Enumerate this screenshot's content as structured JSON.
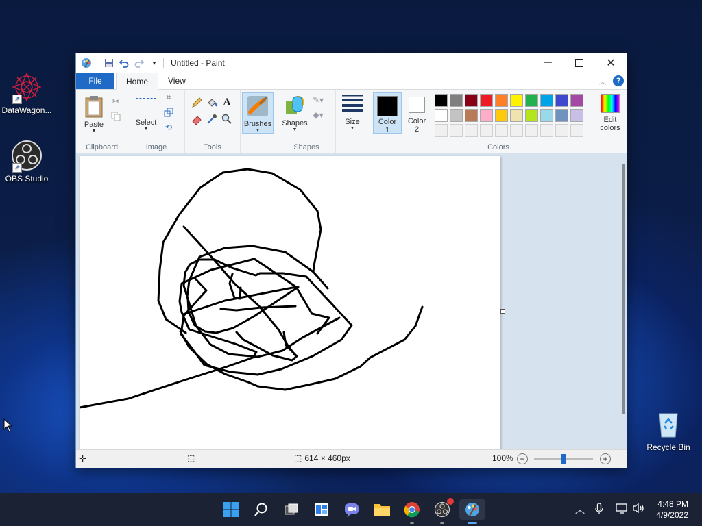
{
  "desktop": {
    "icons": [
      {
        "label": "DataWagon..."
      },
      {
        "label": "OBS Studio"
      },
      {
        "label": "Recycle Bin"
      }
    ]
  },
  "window": {
    "title": "Untitled - Paint",
    "tabs": {
      "file": "File",
      "home": "Home",
      "view": "View"
    }
  },
  "ribbon": {
    "clipboard": {
      "label": "Clipboard",
      "paste": "Paste"
    },
    "image": {
      "label": "Image",
      "select": "Select"
    },
    "tools": {
      "label": "Tools"
    },
    "brushes": {
      "label": "Brushes"
    },
    "shapes": {
      "label": "Shapes",
      "shapes_btn": "Shapes"
    },
    "size": {
      "label": "Size"
    },
    "colors": {
      "label": "Colors",
      "color1": "Color 1",
      "color1_a": "Color",
      "color1_b": "1",
      "color2_a": "Color",
      "color2_b": "2",
      "edit_a": "Edit",
      "edit_b": "colors",
      "color1_value": "#000000",
      "color2_value": "#ffffff",
      "palette_row1": [
        "#000000",
        "#7f7f7f",
        "#880015",
        "#ed1c24",
        "#ff7f27",
        "#fff200",
        "#22b14c",
        "#00a2e8",
        "#3f48cc",
        "#a349a4"
      ],
      "palette_row2": [
        "#ffffff",
        "#c3c3c3",
        "#b97a57",
        "#ffaec9",
        "#ffc90e",
        "#efe4b0",
        "#b5e61d",
        "#99d9ea",
        "#7092be",
        "#c8bfe7"
      ],
      "palette_row3": [
        "#f0f0f0",
        "#f0f0f0",
        "#f0f0f0",
        "#f0f0f0",
        "#f0f0f0",
        "#f0f0f0",
        "#f0f0f0",
        "#f0f0f0",
        "#f0f0f0",
        "#f0f0f0"
      ]
    }
  },
  "status": {
    "image_size": "614 × 460px",
    "zoom": "100%",
    "zoom_fraction": 0.5
  },
  "taskbar": {
    "time": "4:48 PM",
    "date": "4/9/2022"
  }
}
